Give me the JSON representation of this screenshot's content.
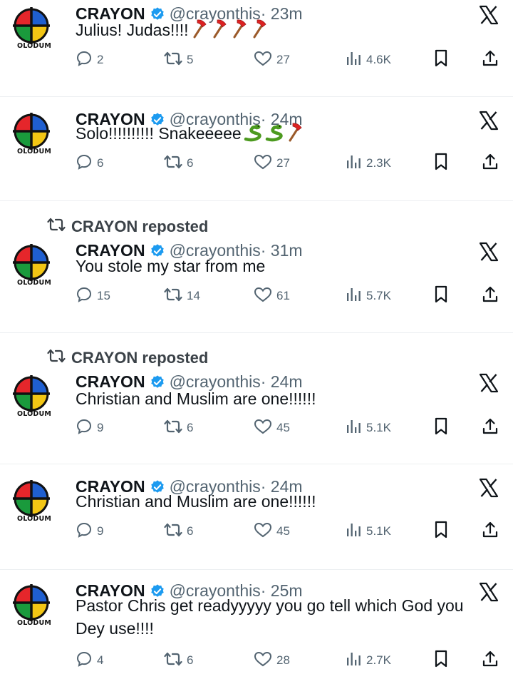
{
  "tweets": [
    {
      "reposted": "",
      "name": "CRAYON",
      "handle": "@crayonthis",
      "time": "· 23m",
      "text": "Julius! Judas!!!!",
      "emoji_after": [
        "axe",
        "axe",
        "axe",
        "axe"
      ],
      "replies": "2",
      "reposts": "5",
      "likes": "27",
      "views": "4.6K"
    },
    {
      "reposted": "",
      "name": "CRAYON",
      "handle": "@crayonthis",
      "time": "· 24m",
      "text": "Solo!!!!!!!!!! Snakeeeee",
      "emoji_after": [
        "snake",
        "snake",
        "axe"
      ],
      "replies": "6",
      "reposts": "6",
      "likes": "27",
      "views": "2.3K"
    },
    {
      "reposted": "CRAYON reposted",
      "name": "CRAYON",
      "handle": "@crayonthis",
      "time": "· 31m",
      "text": "You stole my star from me",
      "emoji_after": [],
      "replies": "15",
      "reposts": "14",
      "likes": "61",
      "views": "5.7K"
    },
    {
      "reposted": "CRAYON reposted",
      "name": "CRAYON",
      "handle": "@crayonthis",
      "time": "· 24m",
      "text": "Christian and Muslim are one!!!!!!",
      "emoji_after": [],
      "replies": "9",
      "reposts": "6",
      "likes": "45",
      "views": "5.1K"
    },
    {
      "reposted": "",
      "name": "CRAYON",
      "handle": "@crayonthis",
      "time": "· 24m",
      "text": "Christian and Muslim are one!!!!!!",
      "emoji_after": [],
      "replies": "9",
      "reposts": "6",
      "likes": "45",
      "views": "5.1K"
    },
    {
      "reposted": "",
      "name": "CRAYON",
      "handle": "@crayonthis",
      "time": "· 25m",
      "text": "Pastor Chris get readyyyyy you go tell which God you Dey use!!!!",
      "emoji_after": [],
      "replies": "4",
      "reposts": "6",
      "likes": "28",
      "views": "2.7K"
    }
  ],
  "avatar_label": "OLODUM",
  "colors": {
    "verified": "#1d9bf0",
    "text": "#0f1419",
    "muted": "#536471",
    "avatar_red": "#e5262b",
    "avatar_blue": "#1f5fd0",
    "avatar_green": "#1a9a3c",
    "avatar_yellow": "#f3c614"
  },
  "icons": {
    "reply": "reply-icon",
    "repost": "repost-icon",
    "like": "heart-icon",
    "views": "views-icon",
    "bookmark": "bookmark-icon",
    "share": "share-icon",
    "brand": "x-logo-icon"
  }
}
